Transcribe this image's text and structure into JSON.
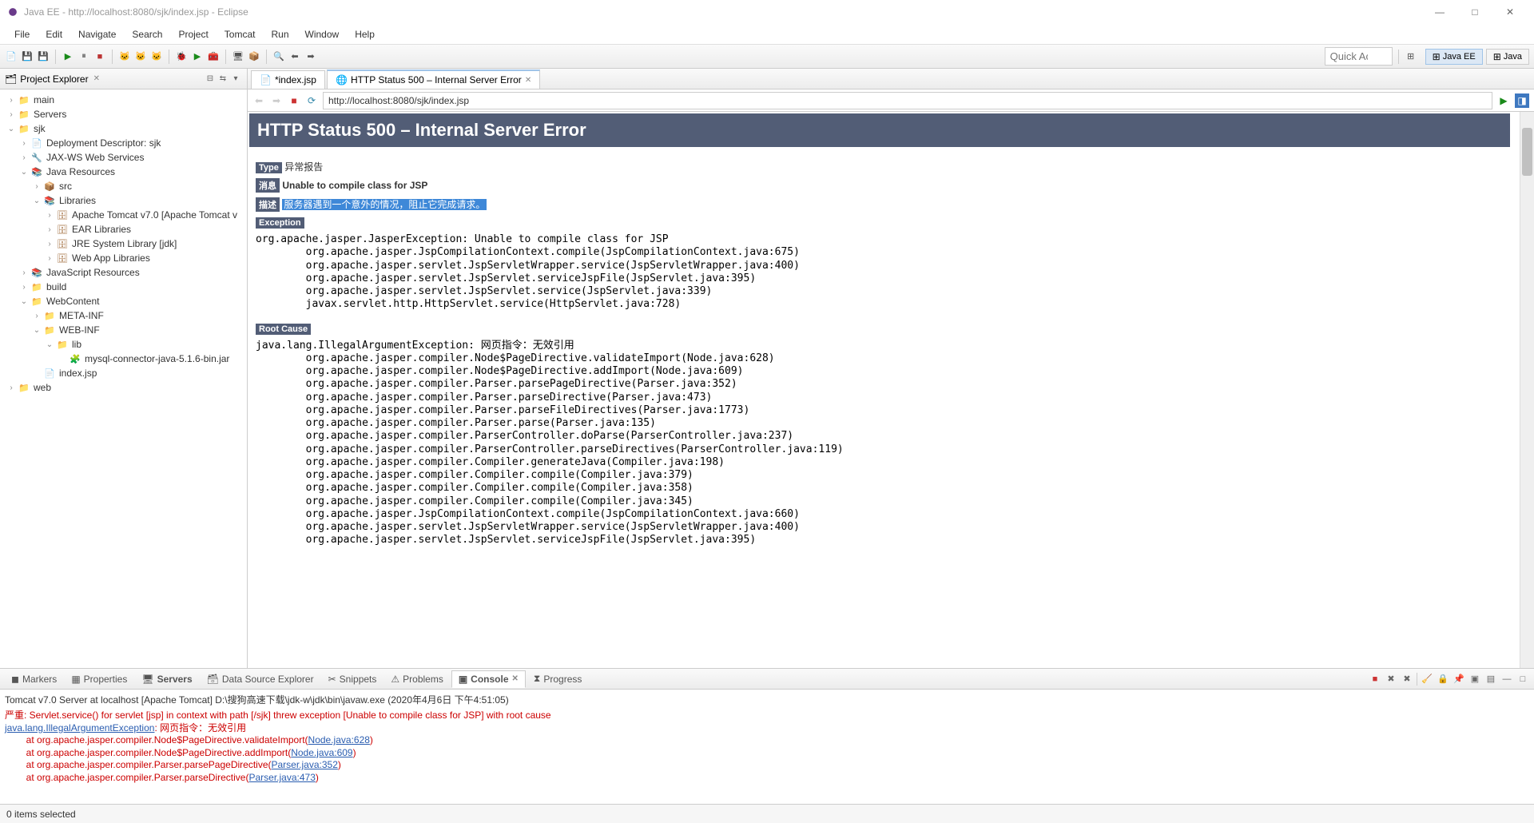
{
  "window": {
    "title": "Java EE - http://localhost:8080/sjk/index.jsp - Eclipse",
    "min": "—",
    "max": "□",
    "close": "✕"
  },
  "menu": [
    "File",
    "Edit",
    "Navigate",
    "Search",
    "Project",
    "Tomcat",
    "Run",
    "Window",
    "Help"
  ],
  "quick_access": "Quick Access",
  "perspectives": [
    {
      "label": "Java EE",
      "active": true
    },
    {
      "label": "Java",
      "active": false
    }
  ],
  "project_explorer": {
    "title": "Project Explorer",
    "tree": [
      {
        "d": 0,
        "tw": "›",
        "ic": "📁",
        "cls": "fld",
        "label": "main"
      },
      {
        "d": 0,
        "tw": "›",
        "ic": "📁",
        "cls": "fld",
        "label": "Servers"
      },
      {
        "d": 0,
        "tw": "⌄",
        "ic": "📁",
        "cls": "fld",
        "label": "sjk"
      },
      {
        "d": 1,
        "tw": "›",
        "ic": "📄",
        "cls": "",
        "label": "Deployment Descriptor: sjk"
      },
      {
        "d": 1,
        "tw": "›",
        "ic": "🔧",
        "cls": "",
        "label": "JAX-WS Web Services"
      },
      {
        "d": 1,
        "tw": "⌄",
        "ic": "📚",
        "cls": "pkg",
        "label": "Java Resources"
      },
      {
        "d": 2,
        "tw": "›",
        "ic": "📦",
        "cls": "pkg",
        "label": "src"
      },
      {
        "d": 2,
        "tw": "⌄",
        "ic": "📚",
        "cls": "jar",
        "label": "Libraries"
      },
      {
        "d": 3,
        "tw": "›",
        "ic": "🗄",
        "cls": "jar",
        "label": "Apache Tomcat v7.0 [Apache Tomcat v"
      },
      {
        "d": 3,
        "tw": "›",
        "ic": "🗄",
        "cls": "jar",
        "label": "EAR Libraries"
      },
      {
        "d": 3,
        "tw": "›",
        "ic": "🗄",
        "cls": "jar",
        "label": "JRE System Library [jdk]"
      },
      {
        "d": 3,
        "tw": "›",
        "ic": "🗄",
        "cls": "jar",
        "label": "Web App Libraries"
      },
      {
        "d": 1,
        "tw": "›",
        "ic": "📚",
        "cls": "jar",
        "label": "JavaScript Resources"
      },
      {
        "d": 1,
        "tw": "›",
        "ic": "📁",
        "cls": "fld",
        "label": "build"
      },
      {
        "d": 1,
        "tw": "⌄",
        "ic": "📁",
        "cls": "fld",
        "label": "WebContent"
      },
      {
        "d": 2,
        "tw": "›",
        "ic": "📁",
        "cls": "fld",
        "label": "META-INF"
      },
      {
        "d": 2,
        "tw": "⌄",
        "ic": "📁",
        "cls": "fld",
        "label": "WEB-INF"
      },
      {
        "d": 3,
        "tw": "⌄",
        "ic": "📁",
        "cls": "fld",
        "label": "lib"
      },
      {
        "d": 4,
        "tw": " ",
        "ic": "🧩",
        "cls": "jf",
        "label": "mysql-connector-java-5.1.6-bin.jar"
      },
      {
        "d": 2,
        "tw": " ",
        "ic": "📄",
        "cls": "jf",
        "label": "index.jsp"
      },
      {
        "d": 0,
        "tw": "›",
        "ic": "📁",
        "cls": "fld",
        "label": "web"
      }
    ]
  },
  "editor_tabs": [
    {
      "label": "*index.jsp",
      "icon": "📄",
      "active": false,
      "dirty": true
    },
    {
      "label": "HTTP Status 500 – Internal Server Error",
      "icon": "🌐",
      "active": true,
      "closable": true
    }
  ],
  "nav_url": "http://localhost:8080/sjk/index.jsp",
  "http_error": {
    "header": "HTTP Status 500 – Internal Server Error",
    "type_label": "Type",
    "type_value": "异常报告",
    "message_label": "消息",
    "message_value": "Unable to compile class for JSP",
    "desc_label": "描述",
    "desc_value": "服务器遇到一个意外的情况，阻止它完成请求。",
    "exception_label": "Exception",
    "exception_trace": "org.apache.jasper.JasperException: Unable to compile class for JSP\n\torg.apache.jasper.JspCompilationContext.compile(JspCompilationContext.java:675)\n\torg.apache.jasper.servlet.JspServletWrapper.service(JspServletWrapper.java:400)\n\torg.apache.jasper.servlet.JspServlet.serviceJspFile(JspServlet.java:395)\n\torg.apache.jasper.servlet.JspServlet.service(JspServlet.java:339)\n\tjavax.servlet.http.HttpServlet.service(HttpServlet.java:728)",
    "rootcause_label": "Root Cause",
    "rootcause_trace": "java.lang.IllegalArgumentException: 网页指令：无效引用\n\torg.apache.jasper.compiler.Node$PageDirective.validateImport(Node.java:628)\n\torg.apache.jasper.compiler.Node$PageDirective.addImport(Node.java:609)\n\torg.apache.jasper.compiler.Parser.parsePageDirective(Parser.java:352)\n\torg.apache.jasper.compiler.Parser.parseDirective(Parser.java:473)\n\torg.apache.jasper.compiler.Parser.parseFileDirectives(Parser.java:1773)\n\torg.apache.jasper.compiler.Parser.parse(Parser.java:135)\n\torg.apache.jasper.compiler.ParserController.doParse(ParserController.java:237)\n\torg.apache.jasper.compiler.ParserController.parseDirectives(ParserController.java:119)\n\torg.apache.jasper.compiler.Compiler.generateJava(Compiler.java:198)\n\torg.apache.jasper.compiler.Compiler.compile(Compiler.java:379)\n\torg.apache.jasper.compiler.Compiler.compile(Compiler.java:358)\n\torg.apache.jasper.compiler.Compiler.compile(Compiler.java:345)\n\torg.apache.jasper.JspCompilationContext.compile(JspCompilationContext.java:660)\n\torg.apache.jasper.servlet.JspServletWrapper.service(JspServletWrapper.java:400)\n\torg.apache.jasper.servlet.JspServlet.serviceJspFile(JspServlet.java:395)"
  },
  "bottom_tabs": [
    {
      "label": "Markers",
      "icon": "◼"
    },
    {
      "label": "Properties",
      "icon": "▦"
    },
    {
      "label": "Servers",
      "icon": "🖥",
      "bold": true
    },
    {
      "label": "Data Source Explorer",
      "icon": "🗃"
    },
    {
      "label": "Snippets",
      "icon": "✂"
    },
    {
      "label": "Problems",
      "icon": "⚠"
    },
    {
      "label": "Console",
      "icon": "▣",
      "active": true,
      "closable": true
    },
    {
      "label": "Progress",
      "icon": "⧗"
    }
  ],
  "console": {
    "server_desc": "Tomcat v7.0 Server at localhost [Apache Tomcat] D:\\搜狗高速下载\\jdk-w\\jdk\\bin\\javaw.exe (2020年4月6日 下午4:51:05)",
    "lines": [
      {
        "t": "严重: Servlet.service() for servlet [jsp] in context with path [/sjk] threw exception [Unable to compile class for JSP] with root cause",
        "cls": "red"
      },
      {
        "t": "java.lang.IllegalArgumentException",
        "cls": "lnk",
        "tail": ": 网页指令：无效引用",
        "tailcls": "red"
      },
      {
        "t": "\tat org.apache.jasper.compiler.Node$PageDirective.validateImport(",
        "cls": "red",
        "link": "Node.java:628",
        "after": ")"
      },
      {
        "t": "\tat org.apache.jasper.compiler.Node$PageDirective.addImport(",
        "cls": "red",
        "link": "Node.java:609",
        "after": ")"
      },
      {
        "t": "\tat org.apache.jasper.compiler.Parser.parsePageDirective(",
        "cls": "red",
        "link": "Parser.java:352",
        "after": ")"
      },
      {
        "t": "\tat org.apache.jasper.compiler.Parser.parseDirective(",
        "cls": "red",
        "link": "Parser.java:473",
        "after": ")"
      }
    ]
  },
  "status": "0 items selected"
}
